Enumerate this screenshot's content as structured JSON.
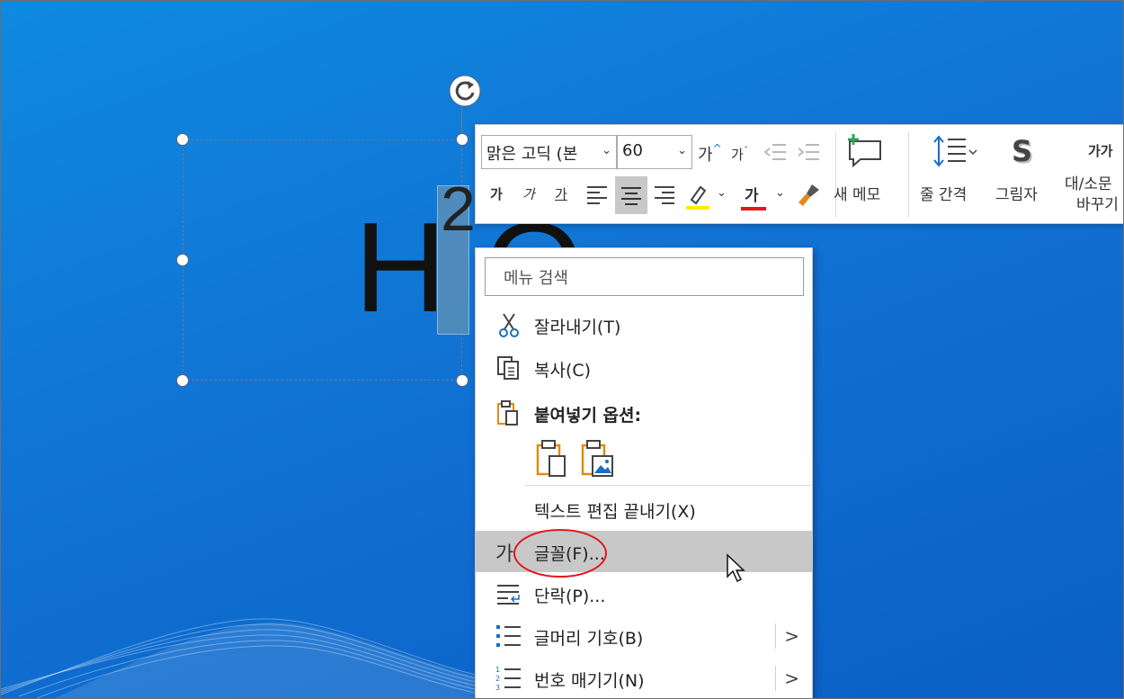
{
  "slide": {
    "text_main_h": "H",
    "text_superscript": "2",
    "text_main_o": "O"
  },
  "mini_toolbar": {
    "font_name": "맑은 고딕 (본",
    "font_size": "60",
    "grow_font": "가",
    "shrink_font": "가",
    "bold": "가",
    "italic": "가",
    "underline": "가",
    "font_color_glyph": "가",
    "new_comment_label": "새 메모",
    "line_spacing_label": "줄 간격",
    "shadow_label": "그림자",
    "shadow_glyph": "S",
    "change_case_glyph": "가가",
    "change_case_label_1": "대/소문",
    "change_case_label_2": "바꾸기",
    "highlight_color": "#ffeb00",
    "font_color": "#e3171f"
  },
  "context_menu": {
    "search_placeholder": "메뉴 검색",
    "items": [
      {
        "label": "잘라내기(T)"
      },
      {
        "label": "복사(C)"
      },
      {
        "label": "붙여넣기 옵션:"
      },
      {
        "label": "텍스트 편집 끝내기(X)"
      },
      {
        "label": "글꼴(F)...",
        "icon_glyph": "가"
      },
      {
        "label": "단락(P)..."
      },
      {
        "label": "글머리 기호(B)"
      },
      {
        "label": "번호 매기기(N)"
      }
    ],
    "submenu_chevron": ">"
  }
}
